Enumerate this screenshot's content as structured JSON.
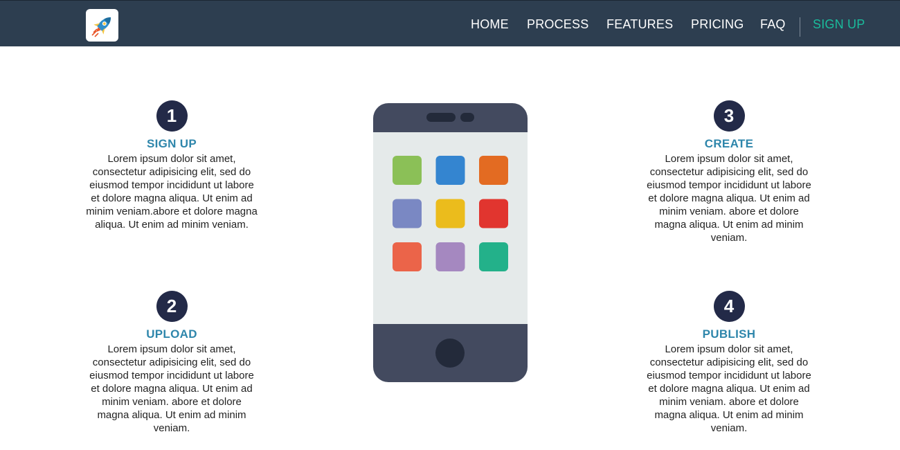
{
  "header": {
    "logo_icon": "rocket-icon",
    "nav": [
      {
        "label": "HOME"
      },
      {
        "label": "PROCESS"
      },
      {
        "label": "FEATURES"
      },
      {
        "label": "PRICING"
      },
      {
        "label": "FAQ"
      }
    ],
    "signup_label": "SIGN UP"
  },
  "steps": [
    {
      "number": "1",
      "title": "SIGN UP",
      "text": "Lorem ipsum dolor sit amet, consectetur adipisicing elit, sed do eiusmod tempor incididunt ut labore et dolore magna aliqua. Ut enim ad minim veniam.abore et dolore magna aliqua. Ut enim ad minim veniam."
    },
    {
      "number": "2",
      "title": "UPLOAD",
      "text": "Lorem ipsum dolor sit amet, consectetur adipisicing elit, sed do eiusmod tempor incididunt ut labore et dolore magna aliqua. Ut enim ad minim veniam. abore et dolore magna aliqua. Ut enim ad minim veniam."
    },
    {
      "number": "3",
      "title": "CREATE",
      "text": "Lorem ipsum dolor sit amet, consectetur adipisicing elit, sed do eiusmod tempor incididunt ut labore et dolore magna aliqua. Ut enim ad minim veniam. abore et dolore magna aliqua. Ut enim ad minim veniam."
    },
    {
      "number": "4",
      "title": "PUBLISH",
      "text": "Lorem ipsum dolor sit amet, consectetur adipisicing elit, sed do eiusmod tempor incididunt ut labore et dolore magna aliqua. Ut enim ad minim veniam. abore et dolore magna aliqua. Ut enim ad minim veniam."
    }
  ],
  "phone": {
    "icon": "smartphone-illustration",
    "app_colors": [
      "#8bc057",
      "#3485d0",
      "#e36b22",
      "#7a88c3",
      "#ebbc1c",
      "#e1352f",
      "#eb6449",
      "#a588c0",
      "#23b18a"
    ]
  },
  "colors": {
    "navbar": "#2d3e50",
    "accent": "#1abc9c",
    "step_title": "#2e86ab",
    "step_circle": "#232a48"
  }
}
